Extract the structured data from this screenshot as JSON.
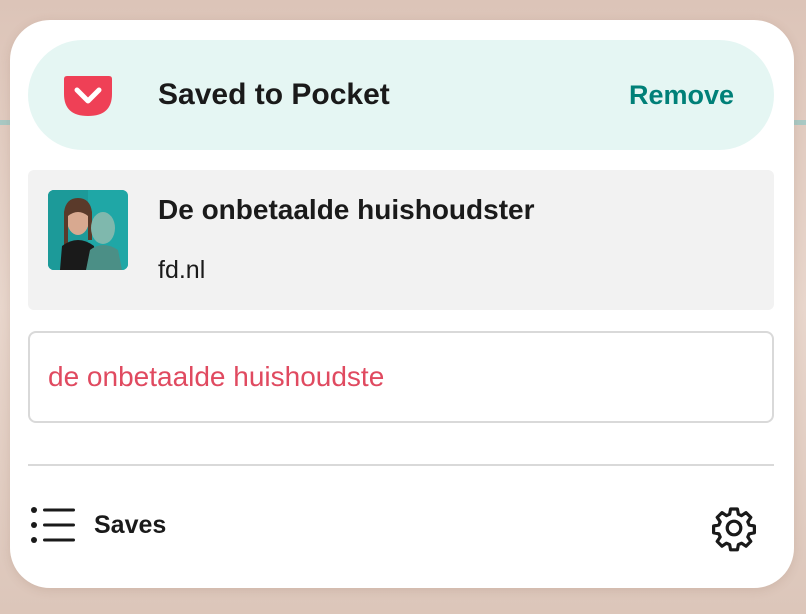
{
  "header": {
    "title": "Saved to Pocket",
    "remove_label": "Remove",
    "logo_icon": "pocket-logo-icon",
    "accent_color": "#ef4056",
    "background_color": "#e5f6f3"
  },
  "article": {
    "title": "De onbetaalde huishoudster",
    "domain": "fd.nl",
    "thumbnail": "article-thumbnail"
  },
  "tag_input": {
    "value": "de onbetaalde huishoudste",
    "text_color": "#e04a60"
  },
  "footer": {
    "saves_label": "Saves",
    "saves_icon": "list-icon",
    "settings_icon": "gear-icon"
  }
}
